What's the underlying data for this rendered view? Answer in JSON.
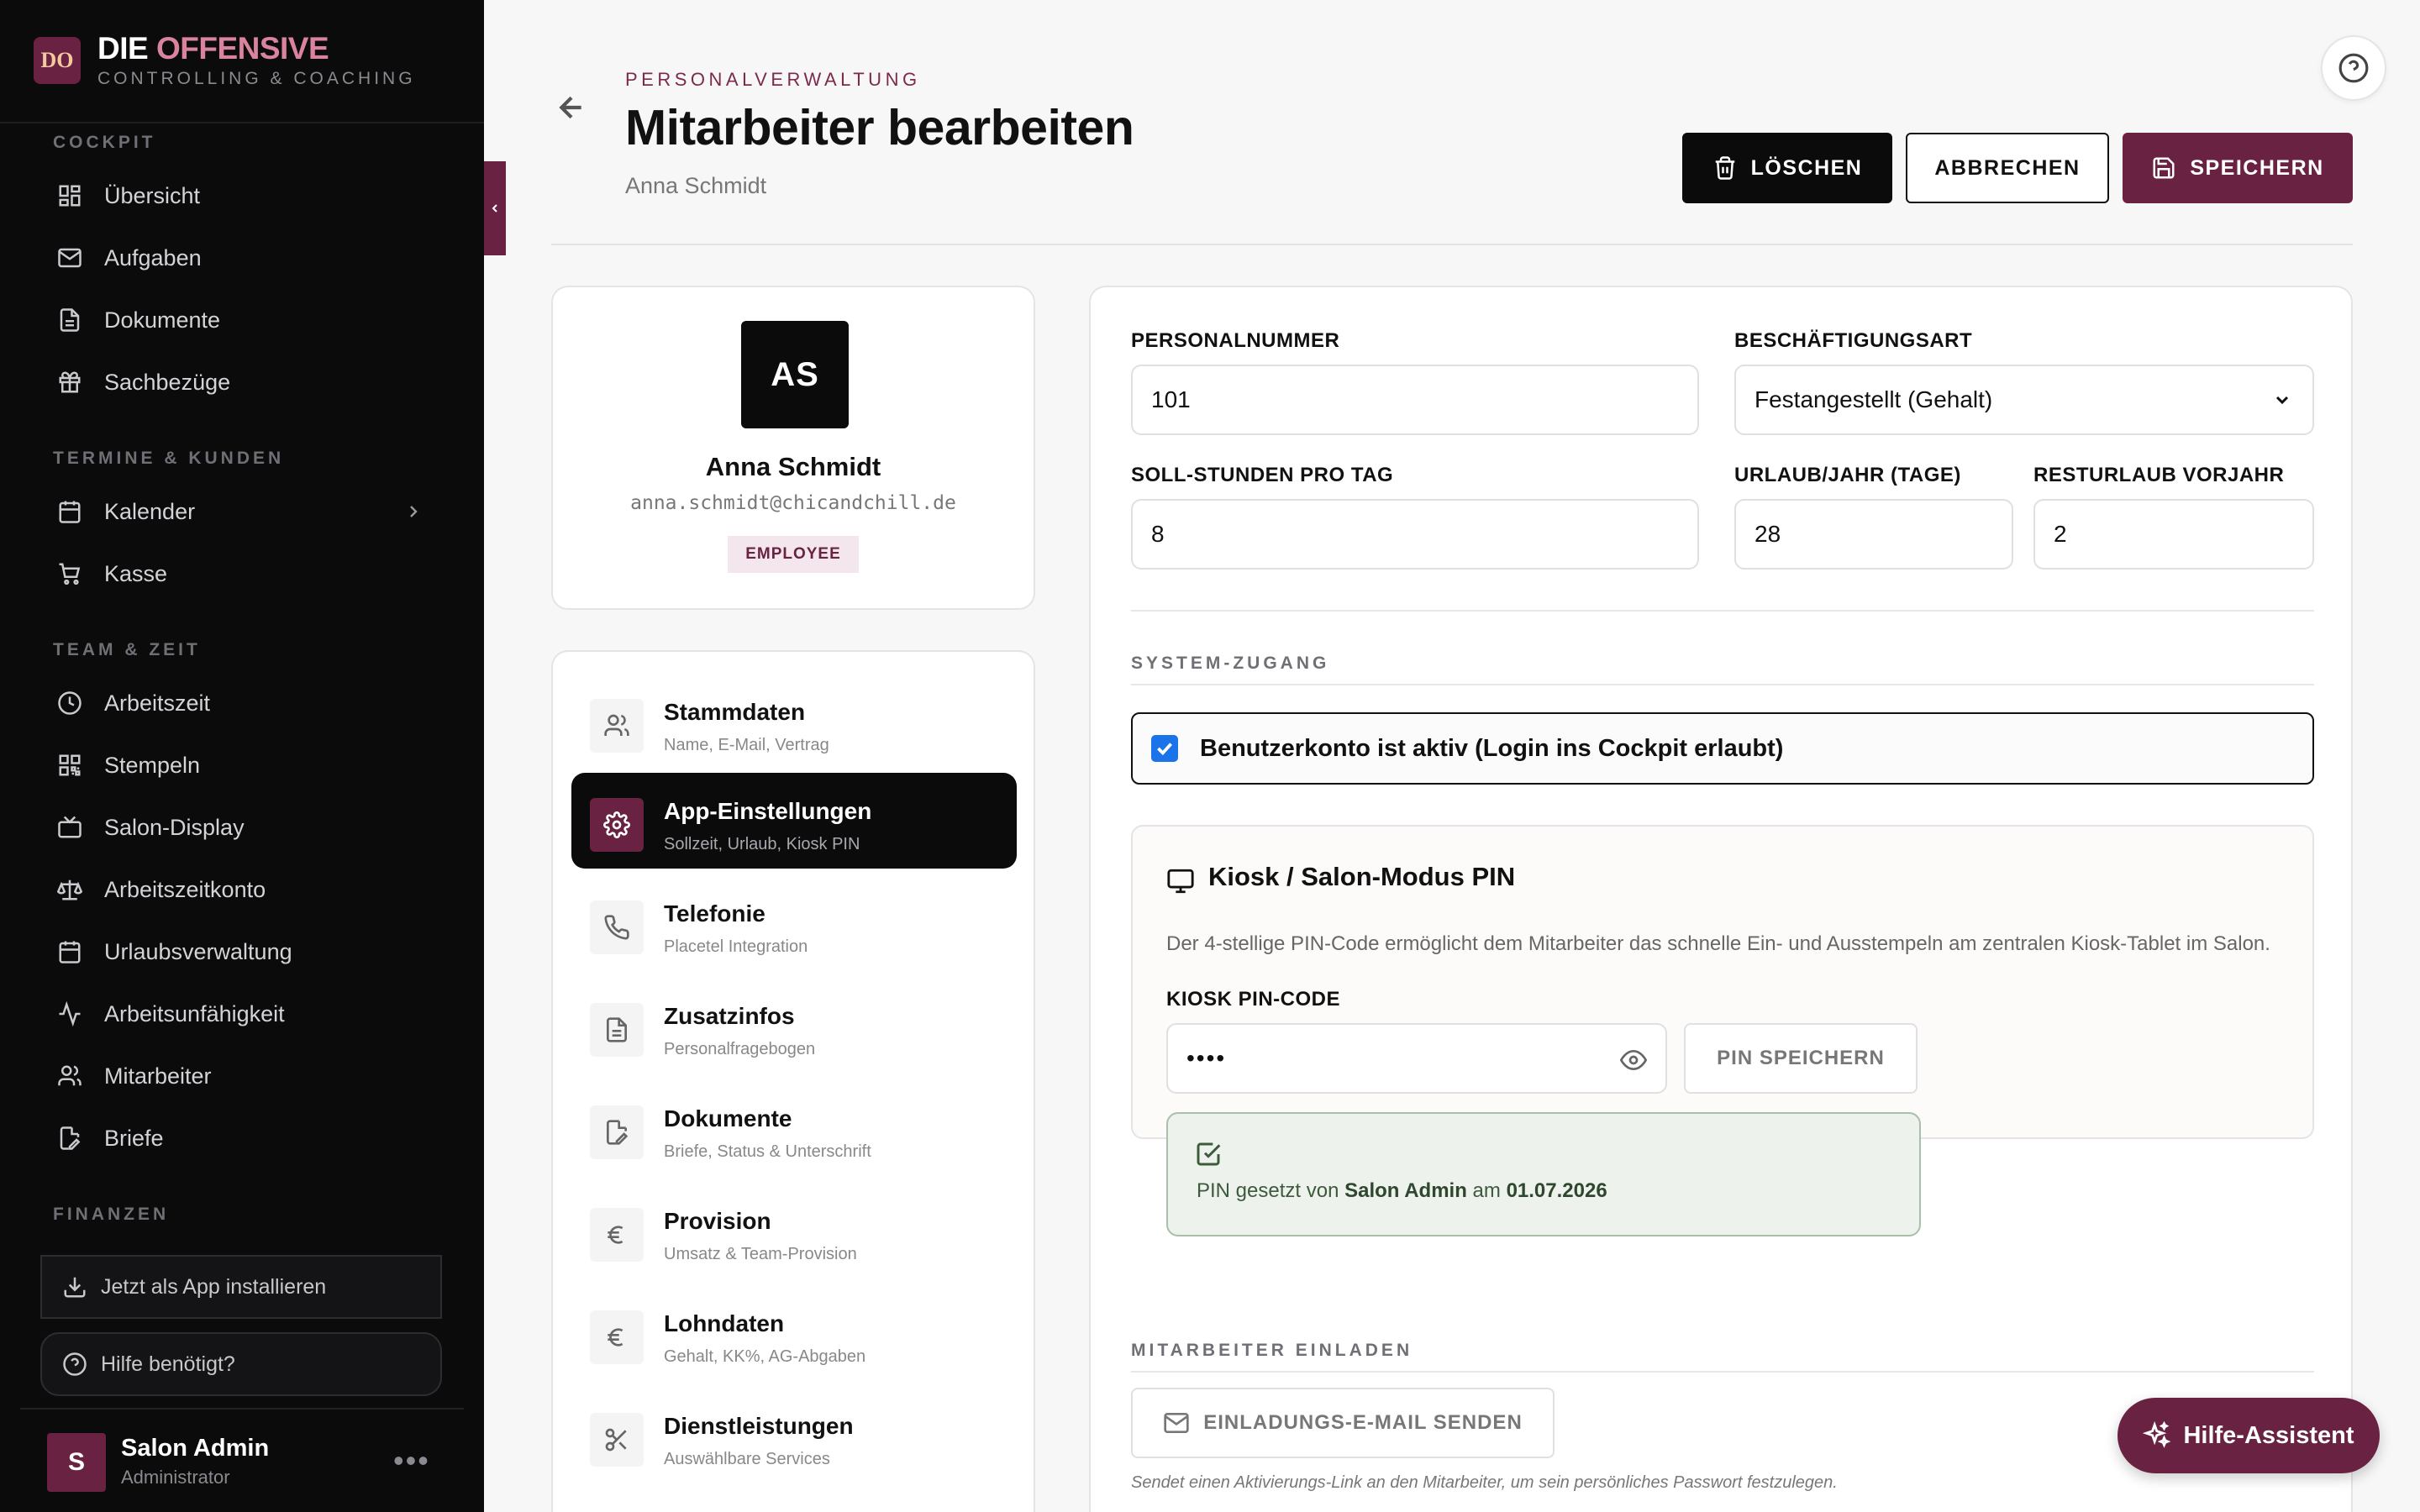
{
  "brand": {
    "logo": "DO",
    "title_main": "DIE",
    "title_accent": "OFFENSIVE",
    "subtitle": "CONTROLLING & COACHING"
  },
  "sidebar": {
    "sections": [
      {
        "label": "COCKPIT",
        "items": [
          {
            "label": "Übersicht",
            "icon": "dashboard-icon"
          },
          {
            "label": "Aufgaben",
            "icon": "mail-icon"
          },
          {
            "label": "Dokumente",
            "icon": "file-icon"
          },
          {
            "label": "Sachbezüge",
            "icon": "gift-icon"
          }
        ]
      },
      {
        "label": "TERMINE & KUNDEN",
        "items": [
          {
            "label": "Kalender",
            "icon": "calendar-icon"
          },
          {
            "label": "Kasse",
            "icon": "cart-icon"
          }
        ]
      },
      {
        "label": "TEAM & ZEIT",
        "items": [
          {
            "label": "Arbeitszeit",
            "icon": "clock-icon"
          },
          {
            "label": "Stempeln",
            "icon": "qr-icon"
          },
          {
            "label": "Salon-Display",
            "icon": "tv-icon"
          },
          {
            "label": "Arbeitszeitkonto",
            "icon": "scale-icon"
          },
          {
            "label": "Urlaubsverwaltung",
            "icon": "calendar-icon"
          },
          {
            "label": "Arbeitsunfähigkeit",
            "icon": "activity-icon"
          },
          {
            "label": "Mitarbeiter",
            "icon": "users-icon"
          },
          {
            "label": "Briefe",
            "icon": "edit-file-icon"
          }
        ]
      },
      {
        "label": "FINANZEN",
        "items": []
      }
    ],
    "install_label": "Jetzt als App installieren",
    "help_label": "Hilfe benötigt?",
    "user": {
      "initial": "S",
      "name": "Salon Admin",
      "role": "Administrator",
      "menu": "•••"
    }
  },
  "header": {
    "eyebrow": "PERSONALVERWALTUNG",
    "title": "Mitarbeiter bearbeiten",
    "subtitle": "Anna Schmidt",
    "delete_label": "LÖSCHEN",
    "cancel_label": "ABBRECHEN",
    "save_label": "SPEICHERN"
  },
  "profile": {
    "initials": "AS",
    "name": "Anna Schmidt",
    "email": "anna.schmidt@chicandchill.de",
    "badge": "EMPLOYEE"
  },
  "tabs": [
    {
      "title": "Stammdaten",
      "sub": "Name, E-Mail, Vertrag",
      "icon": "users-icon",
      "active": false
    },
    {
      "title": "App-Einstellungen",
      "sub": "Sollzeit, Urlaub, Kiosk PIN",
      "icon": "gear-icon",
      "active": true
    },
    {
      "title": "Telefonie",
      "sub": "Placetel Integration",
      "icon": "phone-icon",
      "active": false
    },
    {
      "title": "Zusatzinfos",
      "sub": "Personalfragebogen",
      "icon": "file-icon",
      "active": false
    },
    {
      "title": "Dokumente",
      "sub": "Briefe, Status & Unterschrift",
      "icon": "edit-file-icon",
      "active": false
    },
    {
      "title": "Provision",
      "sub": "Umsatz & Team-Provision",
      "icon": "euro-icon",
      "active": false
    },
    {
      "title": "Lohndaten",
      "sub": "Gehalt, KK%, AG-Abgaben",
      "icon": "euro-icon",
      "active": false
    },
    {
      "title": "Dienstleistungen",
      "sub": "Auswählbare Services",
      "icon": "scissors-icon",
      "active": false
    }
  ],
  "form": {
    "personalnummer_label": "PERSONALNUMMER",
    "personalnummer_value": "101",
    "beschaeftigung_label": "BESCHÄFTIGUNGSART",
    "beschaeftigung_value": "Festangestellt (Gehalt)",
    "soll_label": "SOLL-STUNDEN PRO TAG",
    "soll_value": "8",
    "urlaub_label": "URLAUB/JAHR (TAGE)",
    "urlaub_value": "28",
    "rest_label": "RESTURLAUB VORJAHR",
    "rest_value": "2",
    "system_section": "SYSTEM-ZUGANG",
    "account_active_label": "Benutzerkonto ist aktiv (Login ins Cockpit erlaubt)",
    "kiosk_title": "Kiosk / Salon-Modus PIN",
    "kiosk_desc": "Der 4-stellige PIN-Code ermöglicht dem Mitarbeiter das schnelle Ein- und Ausstempeln am zentralen Kiosk-Tablet im Salon.",
    "kiosk_pin_label": "KIOSK PIN-CODE",
    "kiosk_pin_value": "••••",
    "pin_save_label": "PIN SPEICHERN",
    "pin_status_prefix": "PIN gesetzt von",
    "pin_status_user": "Salon Admin",
    "pin_status_mid": "am",
    "pin_status_date": "01.07.2026",
    "invite_section": "MITARBEITER EINLADEN",
    "invite_button": "EINLADUNGS-E-MAIL SENDEN",
    "invite_note": "Sendet einen Aktivierungs-Link an den Mitarbeiter, um sein persönliches Passwort festzulegen."
  },
  "assistant_label": "Hilfe-Assistent",
  "colors": {
    "accent": "#6a2242",
    "sidebar_bg": "#0b0b0c",
    "success_bg": "#edf2ed"
  }
}
